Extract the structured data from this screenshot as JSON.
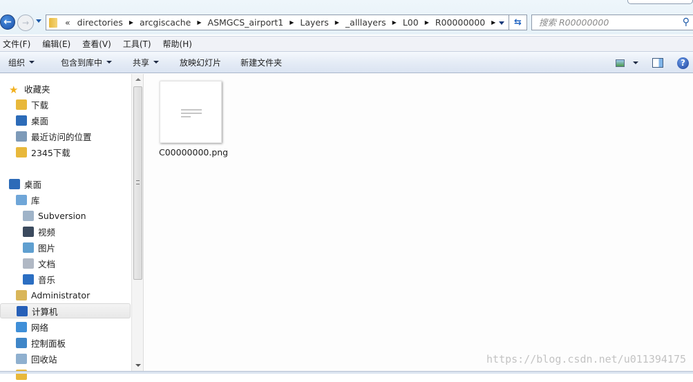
{
  "address": {
    "overflow": "«",
    "segments": [
      "directories",
      "arcgiscache",
      "ASMGCS_airport1",
      "Layers",
      "_alllayers",
      "L00",
      "R00000000"
    ]
  },
  "search": {
    "placeholder": "搜索 R00000000"
  },
  "menu": [
    "文件(F)",
    "编辑(E)",
    "查看(V)",
    "工具(T)",
    "帮助(H)"
  ],
  "toolbar": {
    "organize": "组织",
    "include": "包含到库中",
    "share": "共享",
    "slideshow": "放映幻灯片",
    "new_folder": "新建文件夹"
  },
  "sidebar": [
    {
      "label": "收藏夹",
      "icon": "star-icon",
      "color": "#f2b01e",
      "indent": 0,
      "group": 0
    },
    {
      "label": "下载",
      "icon": "download-folder-icon",
      "color": "#e8b83b",
      "indent": 1,
      "group": 0
    },
    {
      "label": "桌面",
      "icon": "desktop-icon",
      "color": "#2c6bb8",
      "indent": 1,
      "group": 0
    },
    {
      "label": "最近访问的位置",
      "icon": "recent-places-icon",
      "color": "#7d9ab8",
      "indent": 1,
      "group": 0
    },
    {
      "label": "2345下载",
      "icon": "folder-icon",
      "color": "#e8b83b",
      "indent": 1,
      "group": 0
    },
    {
      "label": "桌面",
      "icon": "desktop-icon",
      "color": "#2c6bb8",
      "indent": 0,
      "group": 1
    },
    {
      "label": "库",
      "icon": "library-icon",
      "color": "#6fa6d8",
      "indent": 1,
      "group": 1
    },
    {
      "label": "Subversion",
      "icon": "document-library-icon",
      "color": "#9fb3c8",
      "indent": 2,
      "group": 1
    },
    {
      "label": "视频",
      "icon": "video-icon",
      "color": "#3b4a5e",
      "indent": 2,
      "group": 1
    },
    {
      "label": "图片",
      "icon": "pictures-icon",
      "color": "#5f9fd0",
      "indent": 2,
      "group": 1
    },
    {
      "label": "文档",
      "icon": "documents-icon",
      "color": "#b0b8c4",
      "indent": 2,
      "group": 1
    },
    {
      "label": "音乐",
      "icon": "music-icon",
      "color": "#2b6ec2",
      "indent": 2,
      "group": 1
    },
    {
      "label": "Administrator",
      "icon": "user-folder-icon",
      "color": "#d9b65a",
      "indent": 1,
      "group": 1
    },
    {
      "label": "计算机",
      "icon": "computer-icon",
      "color": "#2760b8",
      "indent": 1,
      "group": 1,
      "selected": true
    },
    {
      "label": "网络",
      "icon": "network-icon",
      "color": "#3f8fd8",
      "indent": 1,
      "group": 1
    },
    {
      "label": "控制面板",
      "icon": "control-panel-icon",
      "color": "#3f86c8",
      "indent": 1,
      "group": 1
    },
    {
      "label": "回收站",
      "icon": "recycle-bin-icon",
      "color": "#8fb0cf",
      "indent": 1,
      "group": 1
    },
    {
      "label": "",
      "icon": "folder-icon",
      "color": "#e8b83b",
      "indent": 1,
      "group": 1
    }
  ],
  "files": [
    {
      "name": "C00000000.png"
    }
  ],
  "watermark": "https://blog.csdn.net/u011394175"
}
